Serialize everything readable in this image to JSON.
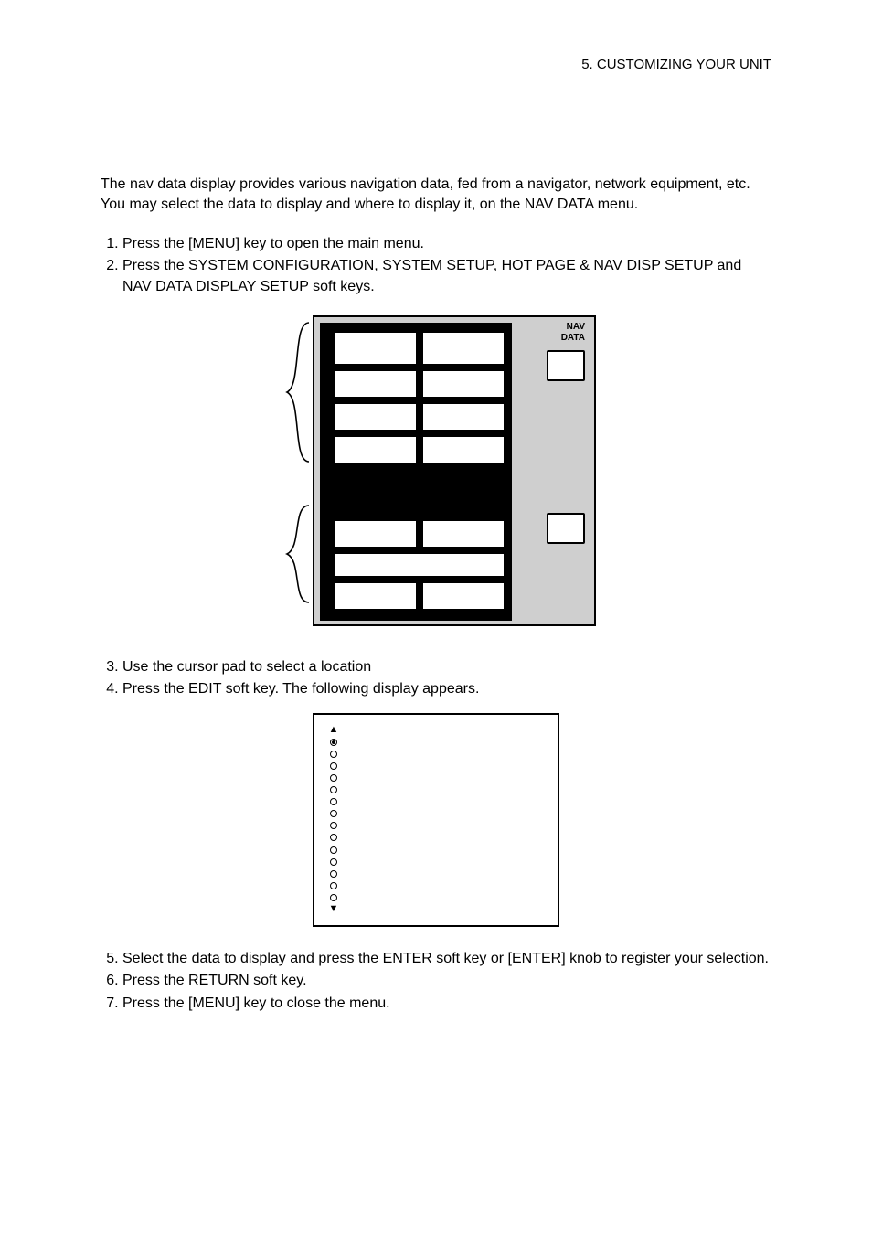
{
  "header": {
    "right": "5. CUSTOMIZING YOUR UNIT"
  },
  "intro": "The nav data display provides various navigation data, fed from a navigator, network equipment, etc. You may select the data to display and where to display it, on the NAV DATA menu.",
  "steps_a": [
    "Press the [MENU] key to open the main menu.",
    "Press the SYSTEM CONFIGURATION, SYSTEM SETUP, HOT PAGE & NAV DISP SETUP and NAV DATA DISPLAY SETUP soft keys."
  ],
  "figure1": {
    "side_label_top": "NAV",
    "side_label_bottom": "DATA"
  },
  "steps_b": [
    "Use the cursor pad to select a location",
    "Press the EDIT soft key. The following display appears."
  ],
  "figure2": {
    "options": [
      "",
      "",
      "",
      "",
      "",
      "",
      "",
      "",
      "",
      "",
      "",
      "",
      "",
      ""
    ]
  },
  "steps_c": [
    "Select the data to display and press the ENTER soft key or [ENTER] knob to register your selection.",
    "Press the RETURN soft key.",
    "Press the [MENU] key to close the menu."
  ]
}
